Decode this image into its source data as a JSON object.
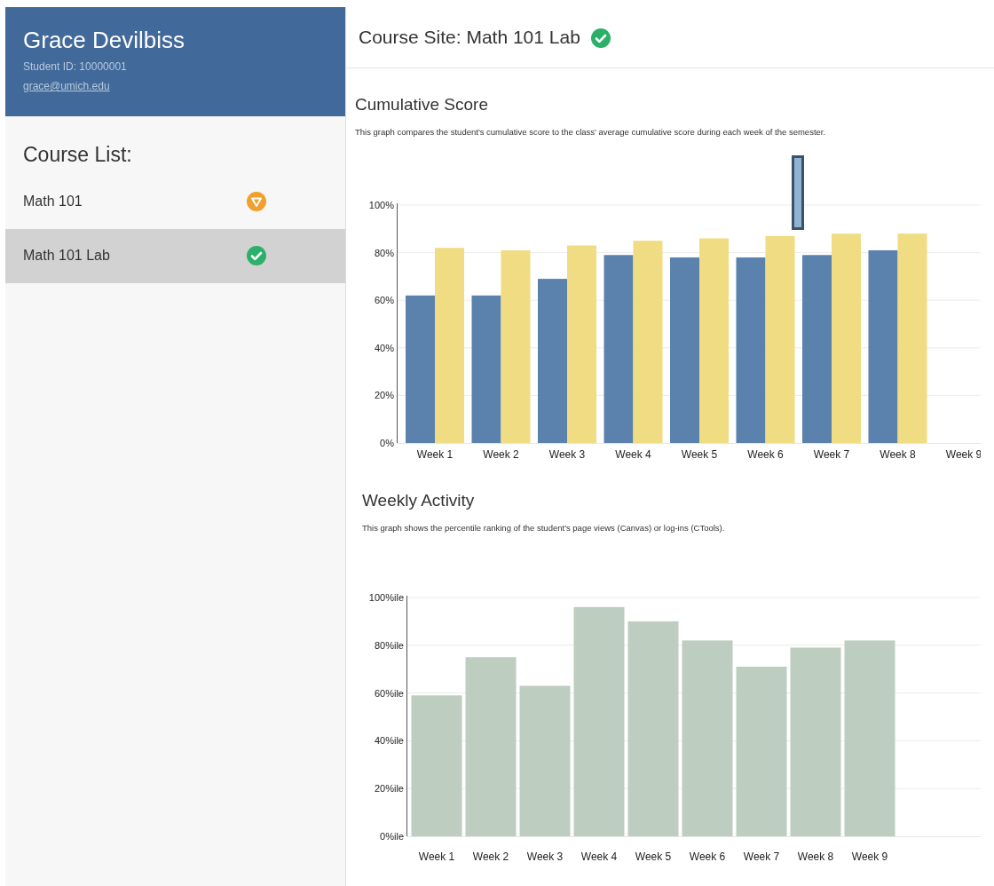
{
  "student": {
    "name": "Grace Devilbiss",
    "id_line": "Student ID: 10000001",
    "email": "grace@umich.edu"
  },
  "course_list": {
    "heading": "Course List:",
    "items": [
      {
        "label": "Math 101",
        "selected": false,
        "kind": "warning",
        "color": "#f0a02c"
      },
      {
        "label": "Math 101 Lab",
        "selected": true,
        "kind": "ok",
        "color": "#2bb06a"
      }
    ]
  },
  "page_title": {
    "text": "Course Site: Math 101 Lab",
    "kind": "ok",
    "color": "#2bb06a"
  },
  "sections": [
    {
      "heading": "Cumulative Score",
      "description": "This graph compares the student's cumulative score to the class' average cumulative score during each week of the semester.",
      "chart_data": {
        "type": "bar",
        "categories": [
          "Week 1",
          "Week 2",
          "Week 3",
          "Week 4",
          "Week 5",
          "Week 6",
          "Week 7",
          "Week 8",
          "Week 9"
        ],
        "series": [
          {
            "color": "#5b82ad",
            "values": [
              62,
              62,
              69,
              79,
              78,
              78,
              79,
              81,
              null
            ]
          },
          {
            "color": "#f0dc82",
            "values": [
              82,
              81,
              83,
              85,
              86,
              87,
              88,
              88,
              null
            ]
          }
        ],
        "ylim": [
          0,
          100
        ],
        "yticks": [
          {
            "value": 0,
            "label": "0%"
          },
          {
            "value": 20,
            "label": "20%"
          },
          {
            "value": 40,
            "label": "40%"
          },
          {
            "value": 60,
            "label": "60%"
          },
          {
            "value": 80,
            "label": "80%"
          },
          {
            "value": 100,
            "label": "100%"
          }
        ],
        "grid": true
      }
    },
    {
      "heading": "Weekly Activity",
      "description": "This graph shows the percentile ranking of the student's page views (Canvas) or log-ins (CTools).",
      "chart_data": {
        "type": "bar",
        "categories": [
          "Week 1",
          "Week 2",
          "Week 3",
          "Week 4",
          "Week 5",
          "Week 6",
          "Week 7",
          "Week 8",
          "Week 9"
        ],
        "series": [
          {
            "color": "#bdcdbf",
            "values": [
              59,
              75,
              63,
              96,
              90,
              82,
              71,
              79,
              82
            ]
          }
        ],
        "ylim": [
          0,
          100
        ],
        "yticks": [
          {
            "value": 0,
            "label": "0%ile"
          },
          {
            "value": 20,
            "label": "20%ile"
          },
          {
            "value": 40,
            "label": "40%ile"
          },
          {
            "value": 60,
            "label": "60%ile"
          },
          {
            "value": 80,
            "label": "80%ile"
          },
          {
            "value": 100,
            "label": "100%ile"
          }
        ],
        "grid": true
      }
    }
  ]
}
